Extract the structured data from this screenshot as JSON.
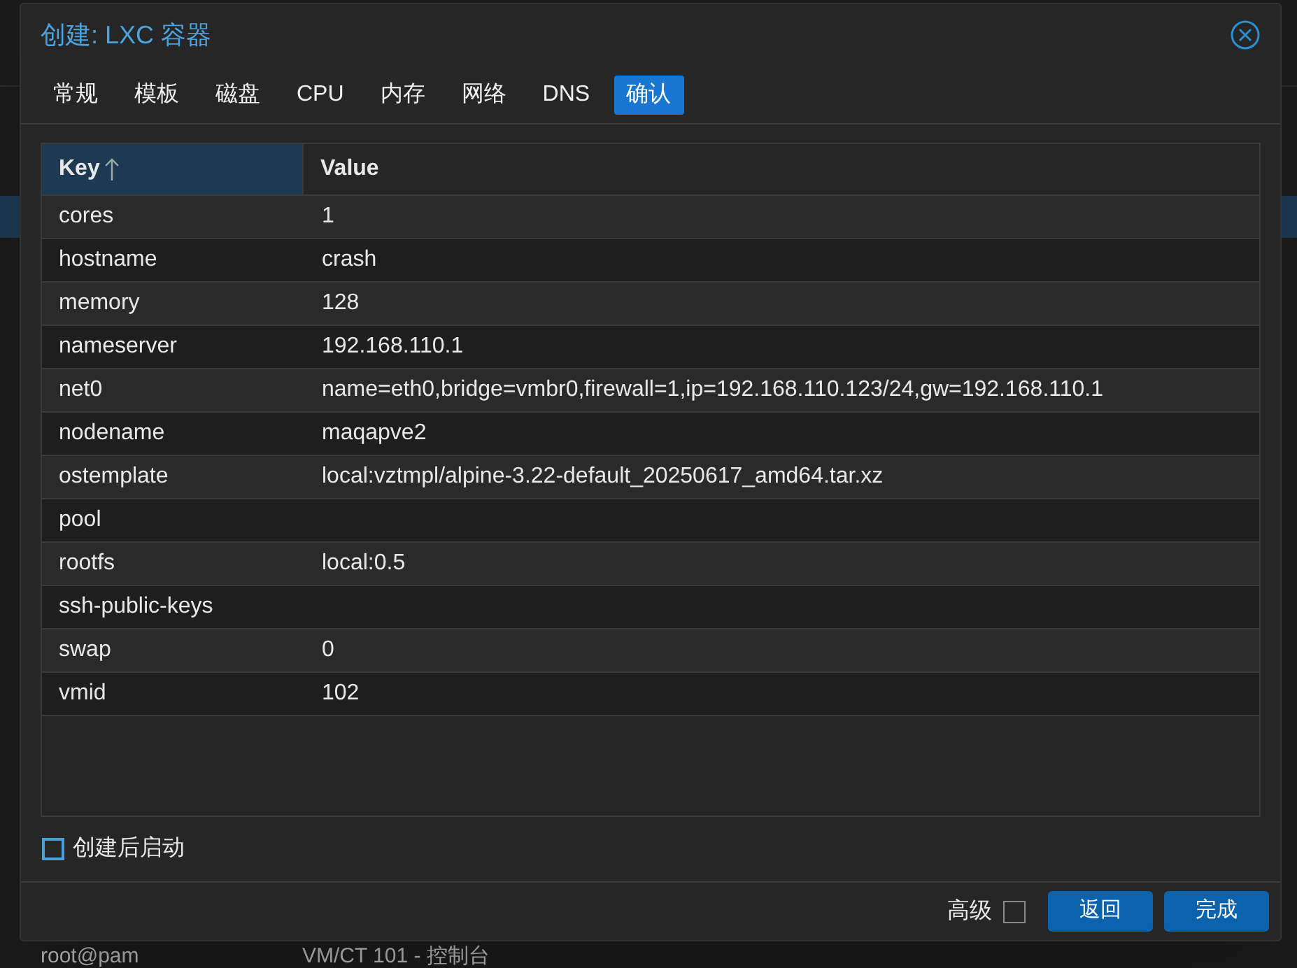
{
  "background": {
    "selected_row": true,
    "bottom_row": [
      "root@pam",
      "VM/CT 101 - 控制台"
    ]
  },
  "dialog": {
    "title": "创建: LXC 容器",
    "tabs": [
      {
        "label": "常规",
        "selected": false
      },
      {
        "label": "模板",
        "selected": false
      },
      {
        "label": "磁盘",
        "selected": false
      },
      {
        "label": "CPU",
        "selected": false
      },
      {
        "label": "内存",
        "selected": false
      },
      {
        "label": "网络",
        "selected": false
      },
      {
        "label": "DNS",
        "selected": false
      },
      {
        "label": "确认",
        "selected": true
      }
    ],
    "table": {
      "columns": [
        {
          "label": "Key",
          "sorted_ascending": true
        },
        {
          "label": "Value"
        }
      ],
      "rows": [
        {
          "key": "cores",
          "value": "1"
        },
        {
          "key": "hostname",
          "value": "crash"
        },
        {
          "key": "memory",
          "value": "128"
        },
        {
          "key": "nameserver",
          "value": "192.168.110.1"
        },
        {
          "key": "net0",
          "value": "name=eth0,bridge=vmbr0,firewall=1,ip=192.168.110.123/24,gw=192.168.110.1"
        },
        {
          "key": "nodename",
          "value": "maqapve2"
        },
        {
          "key": "ostemplate",
          "value": "local:vztmpl/alpine-3.22-default_20250617_amd64.tar.xz"
        },
        {
          "key": "pool"
        },
        {
          "key": "rootfs",
          "value": "local:0.5"
        },
        {
          "key": "ssh-public-keys"
        },
        {
          "key": "swap",
          "value": "0"
        },
        {
          "key": "vmid",
          "value": "102"
        }
      ]
    },
    "start_after_create": {
      "label": "创建后启动",
      "checked": false
    },
    "advanced": {
      "label": "高级",
      "checked": false
    },
    "buttons": [
      "返回",
      "完成"
    ]
  }
}
